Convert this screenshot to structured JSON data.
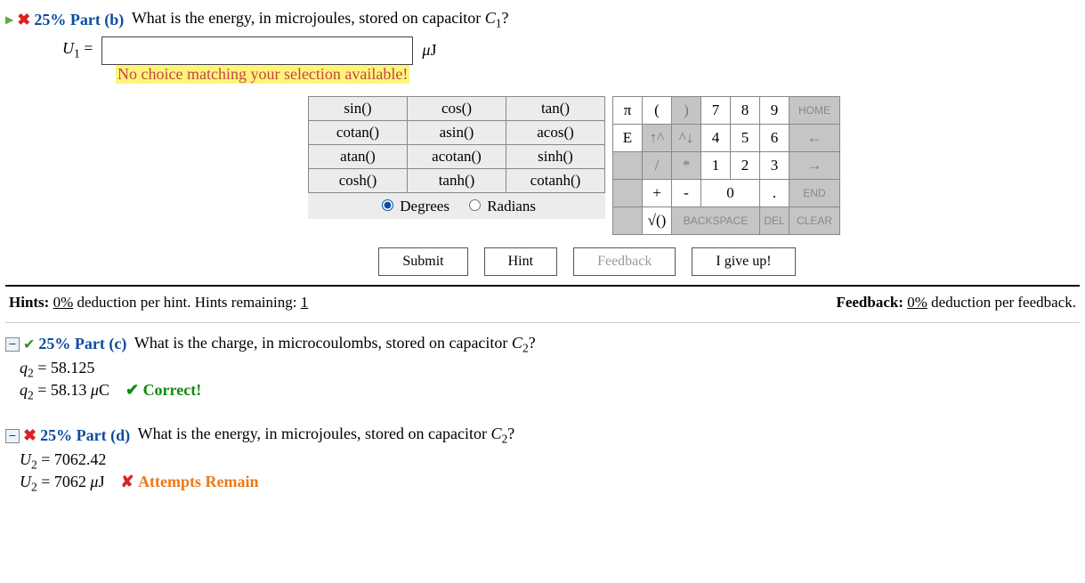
{
  "part_b": {
    "percent": "25%",
    "label": "Part (b)",
    "question_pre": "What is the energy, in microjoules, stored on capacitor ",
    "question_var": "C",
    "question_sub": "1",
    "question_post": "?",
    "var": "U",
    "var_sub": "1",
    "eq": " = ",
    "input_value": "",
    "unit_pre": "μ",
    "unit": "J",
    "warning": "No choice matching your selection available!"
  },
  "keypad": {
    "funcs": [
      [
        "sin()",
        "cos()",
        "tan()"
      ],
      [
        "cotan()",
        "asin()",
        "acos()"
      ],
      [
        "atan()",
        "acotan()",
        "sinh()"
      ],
      [
        "cosh()",
        "tanh()",
        "cotanh()"
      ]
    ],
    "deg": "Degrees",
    "rad": "Radians",
    "row1": [
      "π",
      "(",
      ")",
      "7",
      "8",
      "9",
      "HOME"
    ],
    "row2": [
      "E",
      "↑^",
      "^↓",
      "4",
      "5",
      "6",
      "←"
    ],
    "row3": [
      "",
      "/",
      "*",
      "1",
      "2",
      "3",
      "→"
    ],
    "row4": [
      "",
      "+",
      "-",
      "0",
      ".",
      "END"
    ],
    "row5": [
      "",
      "√()",
      "BACKSPACE",
      "DEL",
      "CLEAR"
    ]
  },
  "actions": {
    "submit": "Submit",
    "hint": "Hint",
    "feedback": "Feedback",
    "giveup": "I give up!"
  },
  "hints": {
    "label1a": "Hints: ",
    "pct1": "0%",
    "label1b": " deduction per hint. Hints remaining: ",
    "remain": "1",
    "label2a": "Feedback: ",
    "pct2": "0%",
    "label2b": " deduction per feedback."
  },
  "part_c": {
    "percent": "25%",
    "label": "Part (c)",
    "question_pre": "What is the charge, in microcoulombs, stored on capacitor ",
    "question_var": "C",
    "question_sub": "2",
    "question_post": "?",
    "l1_var": "q",
    "l1_sub": "2",
    "l1_eq": " = 58.125",
    "l2_var": "q",
    "l2_sub": "2",
    "l2_eq": " = 58.13 ",
    "l2_unit": "μ",
    "l2_unit2": "C",
    "status": "Correct!"
  },
  "part_d": {
    "percent": "25%",
    "label": "Part (d)",
    "question_pre": "What is the energy, in microjoules, stored on capacitor ",
    "question_var": "C",
    "question_sub": "2",
    "question_post": "?",
    "l1_var": "U",
    "l1_sub": "2",
    "l1_eq": " = 7062.42",
    "l2_var": "U",
    "l2_sub": "2",
    "l2_eq": " = 7062 ",
    "l2_unit": "μ",
    "l2_unit2": "J",
    "status": "Attempts Remain"
  }
}
